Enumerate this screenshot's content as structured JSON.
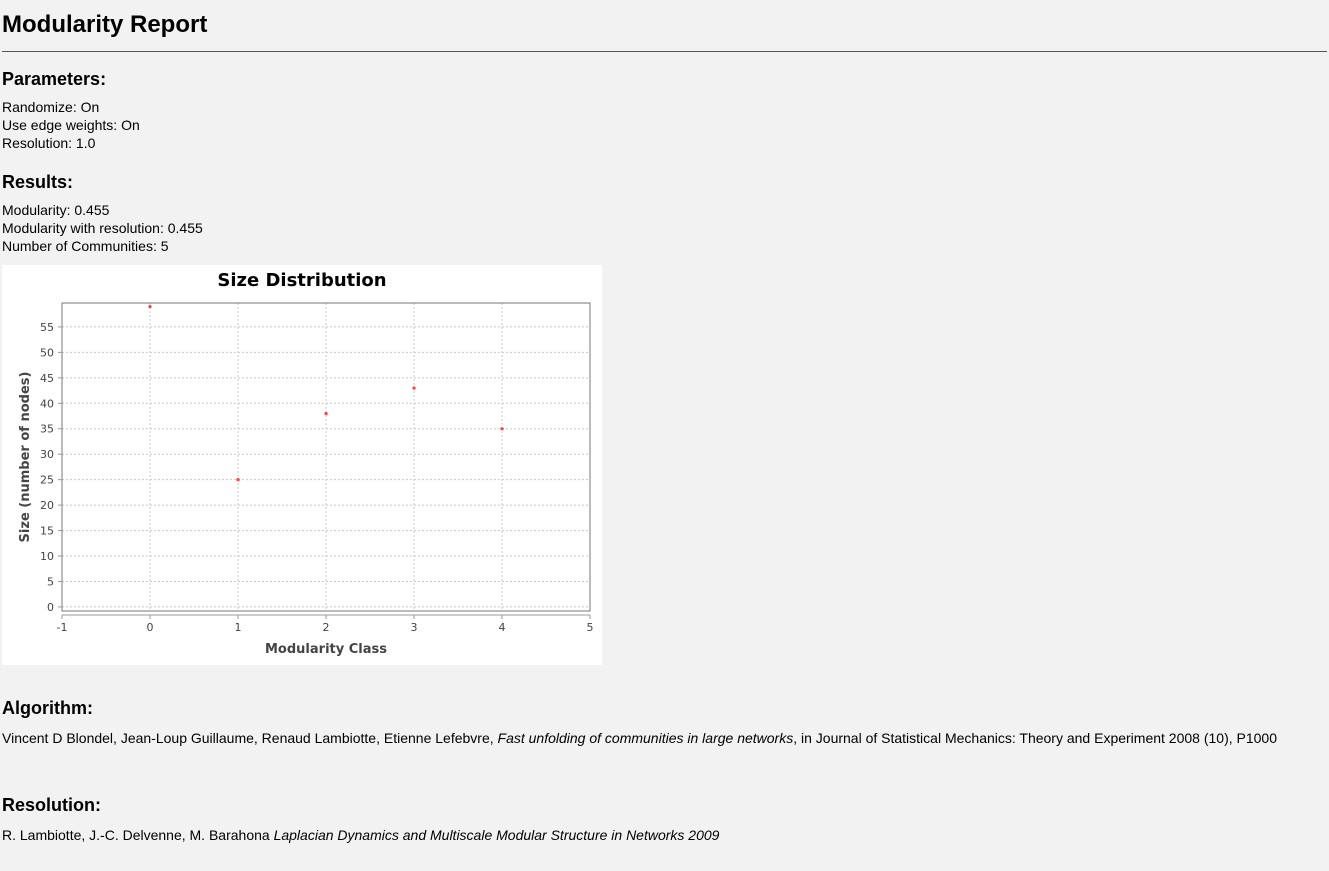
{
  "title": "Modularity Report",
  "parameters": {
    "heading": "Parameters:",
    "lines": [
      "Randomize: On",
      "Use edge weights: On",
      "Resolution: 1.0"
    ]
  },
  "results": {
    "heading": "Results:",
    "lines": [
      "Modularity: 0.455",
      "Modularity with resolution: 0.455",
      "Number of Communities: 5"
    ]
  },
  "chart_data": {
    "type": "scatter",
    "title": "Size Distribution",
    "xlabel": "Modularity Class",
    "ylabel": "Size (number of nodes)",
    "x": [
      0,
      1,
      2,
      3,
      4
    ],
    "y": [
      59,
      25,
      38,
      43,
      35
    ],
    "xlim": [
      -1,
      5
    ],
    "ylim": [
      -0.8,
      59.7
    ],
    "xticks": [
      -1,
      0,
      1,
      2,
      3,
      4,
      5
    ],
    "yticks": [
      0,
      5,
      10,
      15,
      20,
      25,
      30,
      35,
      40,
      45,
      50,
      55
    ],
    "grid": true,
    "point_color": "#ff4040"
  },
  "algorithm": {
    "heading": "Algorithm:",
    "authors": "Vincent D Blondel, Jean-Loup Guillaume, Renaud Lambiotte, Etienne Lefebvre, ",
    "paper": "Fast unfolding of communities in large networks",
    "rest": ", in Journal of Statistical Mechanics: Theory and Experiment 2008 (10), P1000"
  },
  "resolution": {
    "heading": "Resolution:",
    "authors": "R. Lambiotte, J.-C. Delvenne, M. Barahona ",
    "paper": "Laplacian Dynamics and Multiscale Modular Structure in Networks 2009"
  }
}
